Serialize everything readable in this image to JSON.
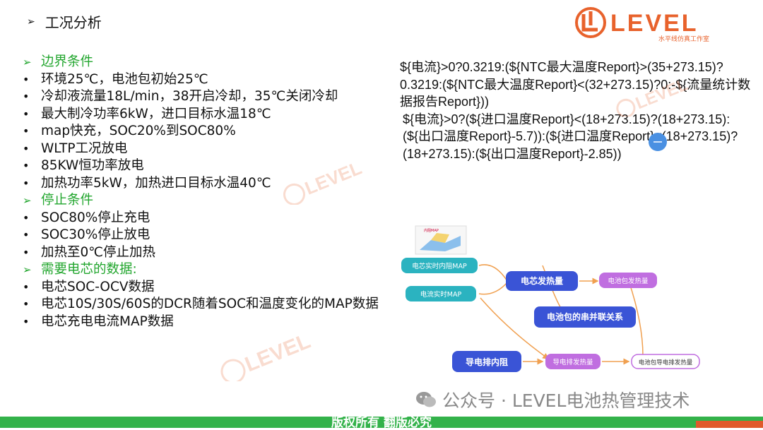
{
  "title": {
    "arrow": "➢",
    "text": "工况分析"
  },
  "logo": {
    "brand": "LEVEL",
    "sub": "水平线仿真工作室"
  },
  "left": {
    "rows": [
      {
        "type": "hd",
        "text": "边界条件"
      },
      {
        "type": "bl",
        "text": "环境25℃，电池包初始25℃"
      },
      {
        "type": "bl",
        "text": "冷却液流量18L/min，38开启冷却，35℃关闭冷却"
      },
      {
        "type": "bl",
        "text": "最大制冷功率6kW，进口目标水温18℃"
      },
      {
        "type": "bl",
        "text": "map快充，SOC20%到SOC80%"
      },
      {
        "type": "bl",
        "text": "WLTP工况放电"
      },
      {
        "type": "bl",
        "text": "85KW恒功率放电"
      },
      {
        "type": "bl",
        "text": "加热功率5kW，加热进口目标水温40℃"
      },
      {
        "type": "hd",
        "text": "停止条件"
      },
      {
        "type": "bl",
        "text": "SOC80%停止充电"
      },
      {
        "type": "bl",
        "text": "SOC30%停止放电"
      },
      {
        "type": "bl",
        "text": "加热至0℃停止加热"
      },
      {
        "type": "hd",
        "text": "需要电芯的数据:"
      },
      {
        "type": "bl",
        "text": "电芯SOC-OCV数据"
      },
      {
        "type": "bl",
        "text": "电芯10S/30S/60S的DCR随着SOC和温度变化的MAP数据"
      },
      {
        "type": "bl",
        "text": "电芯充电电流MAP数据"
      }
    ],
    "bullet": "•",
    "hd_marker": "➢"
  },
  "formula": {
    "line1": "${电流}>0?0.3219:(${NTC最大温度Report}>(35+273.15)?0.3219:(${NTC最大温度Report}<(32+273.15)?0:-${流量统计数据报告Report}))",
    "line2": "${电流}>0?(${进口温度Report}<(18+273.15)?(18+273.15):(${出口温度Report}-5.7)):(${进口温度Report}<(18+273.15)?(18+273.15):(${出口温度Report}-2.85))"
  },
  "diagram": {
    "thumb_title": "内阻MAP",
    "nodes": {
      "n1": "电芯实时内阻MAP",
      "n2": "电流实时MAP",
      "n3": "电芯发热量",
      "n4": "电池包发热量",
      "n5": "电池包的串并联关系",
      "n6": "导电排内阻",
      "n7": "导电排发热量",
      "n8": "电池包导电排发热量"
    },
    "colors": {
      "teal": "#2bb3c0",
      "navy": "#3a54d6",
      "purple": "#c06ee0",
      "orange": "#f0a050"
    }
  },
  "footer": {
    "wechat": "公众号 · LEVEL电池热管理技术",
    "copyright": "版权所有 翻版必究"
  },
  "colors": {
    "green": "#22a62e",
    "bar": "#33b24a",
    "logo_orange": "#e8622c"
  }
}
